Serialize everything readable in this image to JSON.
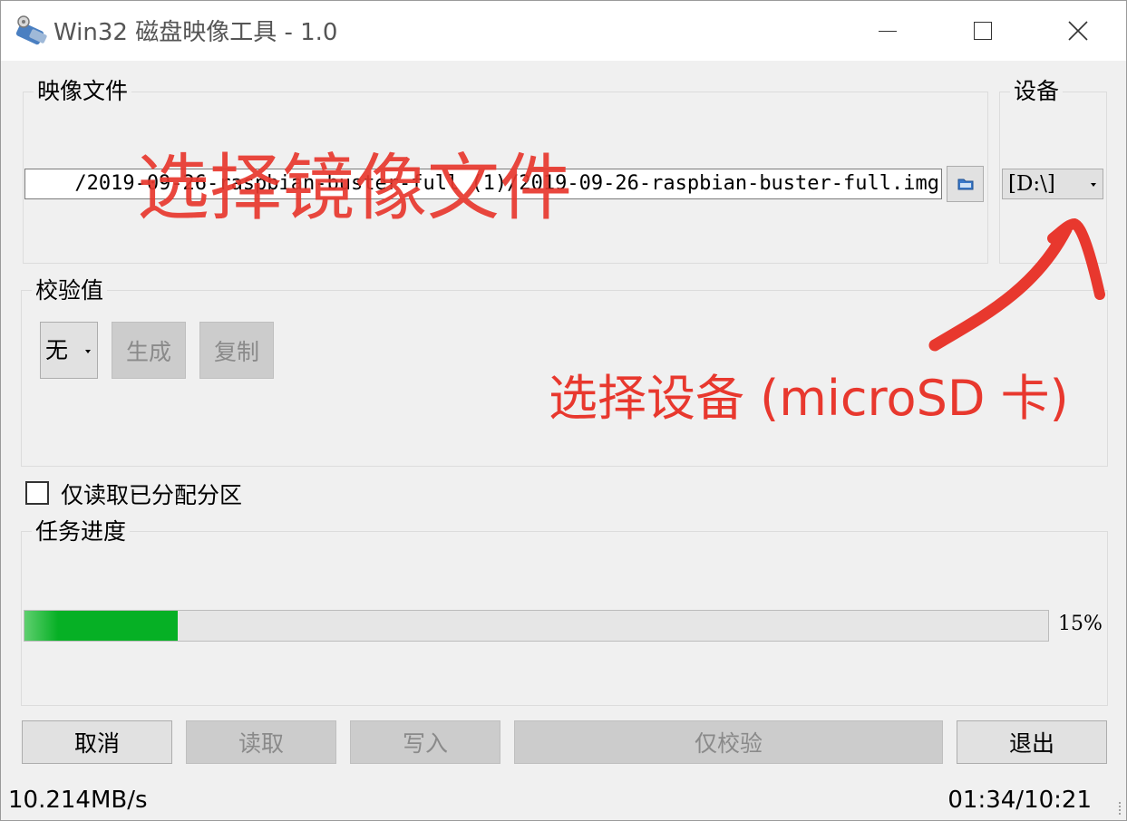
{
  "window": {
    "title": "Win32 磁盘映像工具 - 1.0",
    "icon": "disk-imager-app-icon",
    "controls": {
      "minimize": "minimize-icon",
      "maximize": "maximize-icon",
      "close": "close-icon"
    }
  },
  "image_file": {
    "group_label": "映像文件",
    "path_value": "/2019-09-26-raspbian-buster-full (1)/2019-09-26-raspbian-buster-full.img",
    "browse_icon": "folder-icon"
  },
  "device": {
    "group_label": "设备",
    "selected": "[D:\\]"
  },
  "hash": {
    "group_label": "校验值",
    "selected": "无",
    "generate_label": "生成",
    "copy_label": "复制"
  },
  "read_only_option": {
    "label": "仅读取已分配分区",
    "checked": false
  },
  "progress": {
    "group_label": "任务进度",
    "percent": 15,
    "percent_text": "15%",
    "fill_color": "#06b025"
  },
  "actions": {
    "cancel": "取消",
    "read": "读取",
    "write": "写入",
    "verify_only": "仅校验",
    "exit": "退出"
  },
  "status": {
    "speed": "10.214MB/s",
    "time": "01:34/10:21"
  },
  "annotations": {
    "select_file": "选择镜像文件",
    "select_device": "选择设备 (microSD 卡)",
    "color": "#e8382e"
  }
}
